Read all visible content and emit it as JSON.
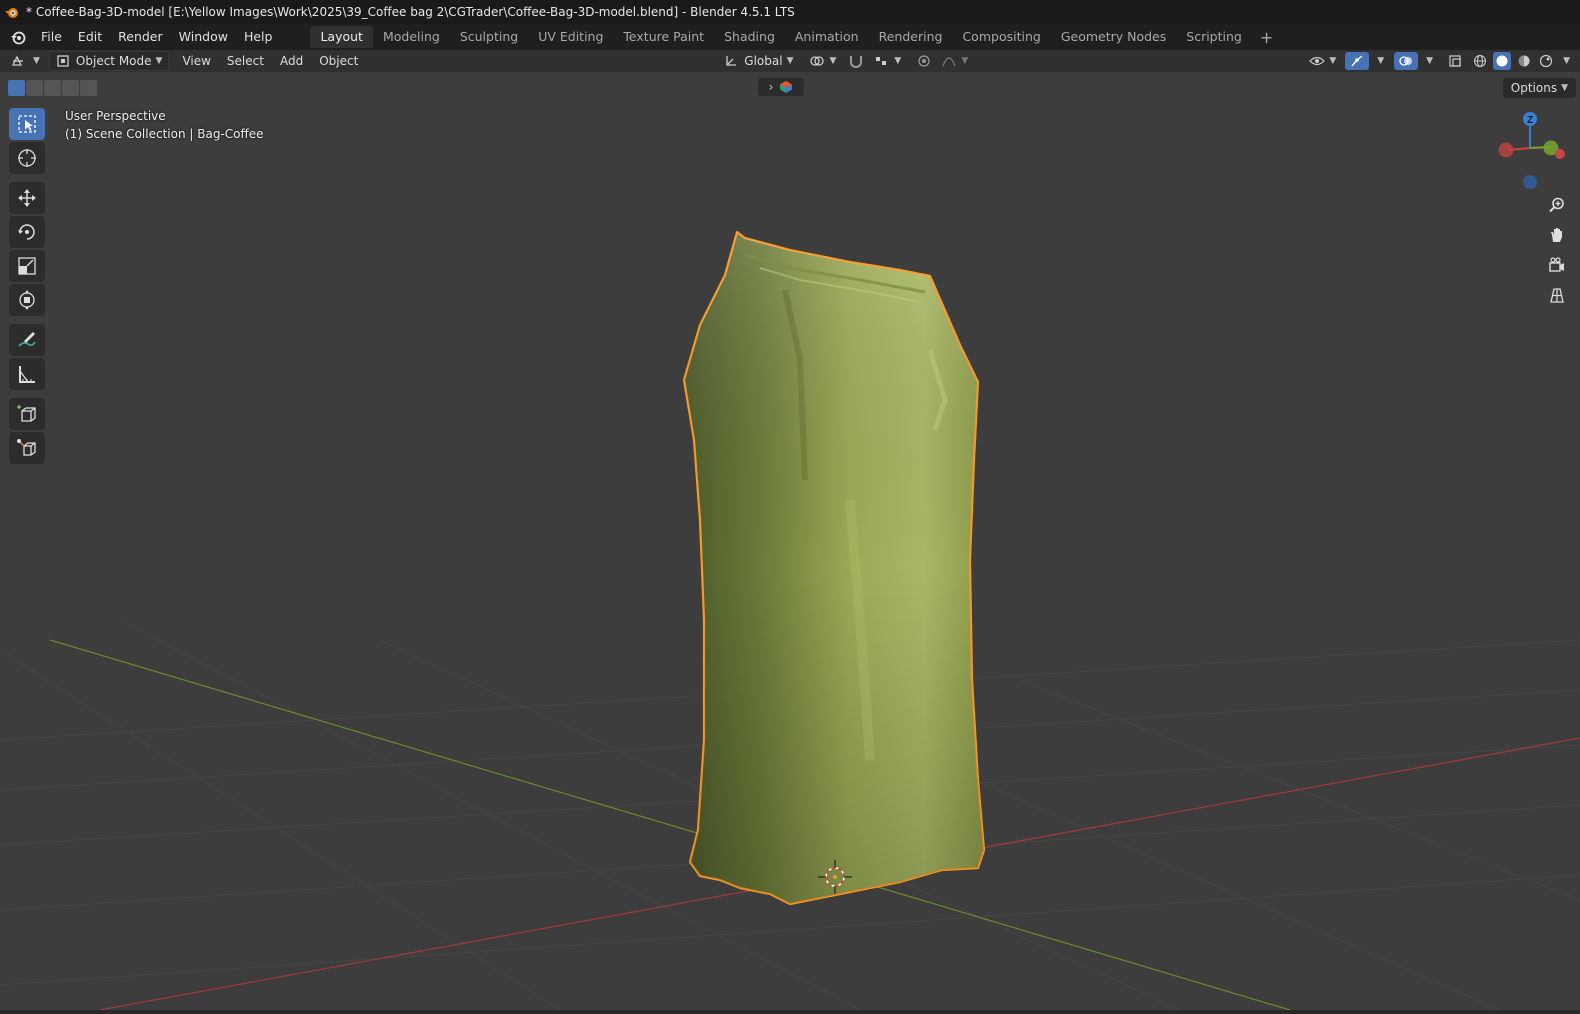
{
  "window": {
    "title": "* Coffee-Bag-3D-model [E:\\Yellow Images\\Work\\2025\\39_Coffee bag 2\\CGTrader\\Coffee-Bag-3D-model.blend] - Blender 4.5.1 LTS"
  },
  "menubar": {
    "items": [
      "File",
      "Edit",
      "Render",
      "Window",
      "Help"
    ]
  },
  "workspaces": {
    "tabs": [
      "Layout",
      "Modeling",
      "Sculpting",
      "UV Editing",
      "Texture Paint",
      "Shading",
      "Animation",
      "Rendering",
      "Compositing",
      "Geometry Nodes",
      "Scripting"
    ],
    "active": "Layout",
    "add_label": "+"
  },
  "header": {
    "mode": "Object Mode",
    "menus": [
      "View",
      "Select",
      "Add",
      "Object"
    ],
    "orientation": "Global",
    "options_label": "Options"
  },
  "viewport": {
    "perspective_label": "User Perspective",
    "collection_label": "(1) Scene Collection | Bag-Coffee",
    "gizmo_axis_z": "Z",
    "object_color": "#8a9a4a",
    "selection_outline_color": "#f59a2a",
    "x_axis_color": "#b13a3a",
    "y_axis_color": "#6e8a2a"
  },
  "tools": [
    "select-box-icon",
    "cursor-icon",
    "move-icon",
    "rotate-icon",
    "scale-icon",
    "transform-icon",
    "annotate-icon",
    "measure-icon",
    "add-cube-icon",
    "extrude-icon"
  ],
  "nav_gizmos": [
    "zoom-icon",
    "pan-hand-icon",
    "camera-view-icon",
    "ortho-grid-icon"
  ]
}
